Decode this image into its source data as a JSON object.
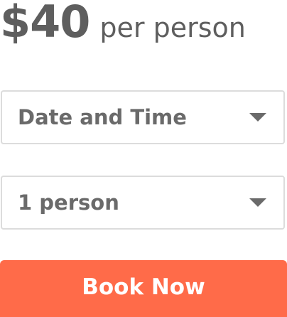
{
  "price": {
    "amount": "$40",
    "unit": "per person"
  },
  "date_time_select": {
    "value": "Date and Time",
    "icon": "caret-down-icon"
  },
  "guests_select": {
    "value": "1 person",
    "icon": "caret-down-icon"
  },
  "book_button": {
    "label": "Book Now",
    "color": "#ff6b49"
  }
}
